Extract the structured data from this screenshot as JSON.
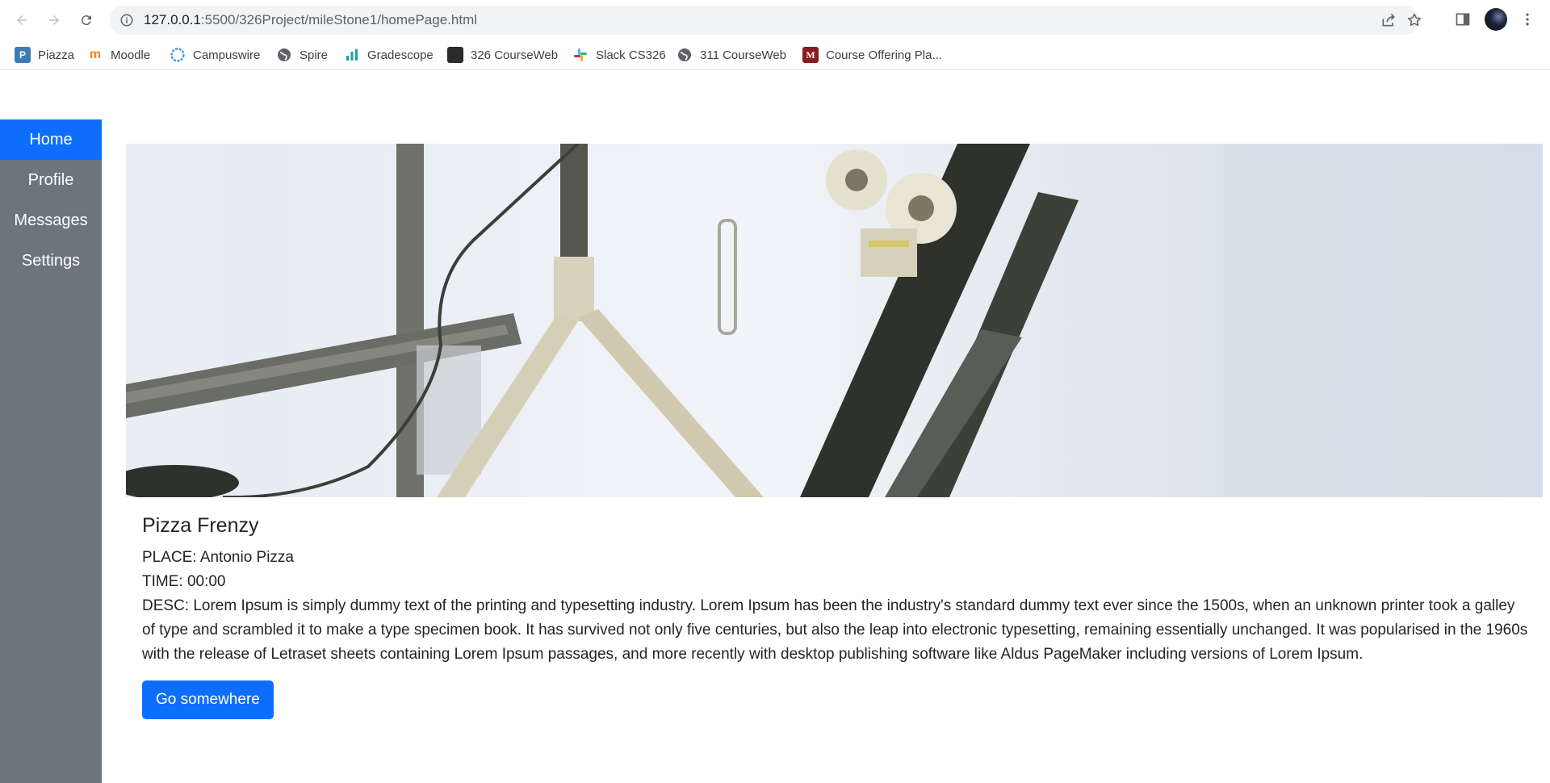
{
  "browser": {
    "url_host": "127.0.0.1",
    "url_path": ":5500/326Project/mileStone1/homePage.html",
    "bookmarks": [
      {
        "label": "Piazza",
        "icon": "piazza-icon",
        "color": "#3e7ab8"
      },
      {
        "label": "Moodle",
        "icon": "moodle-icon",
        "color": "#f98012"
      },
      {
        "label": "Campuswire",
        "icon": "campuswire-icon",
        "color": "#2d8cf0"
      },
      {
        "label": "Spire",
        "icon": "globe-icon",
        "color": "#5f6368"
      },
      {
        "label": "Gradescope",
        "icon": "gradescope-icon",
        "color": "#1fa0a8"
      },
      {
        "label": "326 CourseWeb",
        "icon": "courseweb-icon",
        "color": "#2b2b2b"
      },
      {
        "label": "Slack CS326",
        "icon": "slack-icon",
        "color": "#e01e5a"
      },
      {
        "label": "311 CourseWeb",
        "icon": "globe-icon",
        "color": "#5f6368"
      },
      {
        "label": "Course Offering Pla...",
        "icon": "umass-icon",
        "color": "#881c1c"
      }
    ]
  },
  "sidebar": {
    "items": [
      {
        "label": "Home",
        "active": true
      },
      {
        "label": "Profile",
        "active": false
      },
      {
        "label": "Messages",
        "active": false
      },
      {
        "label": "Settings",
        "active": false
      }
    ]
  },
  "card": {
    "title": "Pizza Frenzy",
    "place": "PLACE: Antonio Pizza",
    "time": "TIME: 00:00",
    "desc": "DESC: Lorem Ipsum is simply dummy text of the printing and typesetting industry. Lorem Ipsum has been the industry's standard dummy text ever since the 1500s, when an unknown printer took a galley of type and scrambled it to make a type specimen book. It has survived not only five centuries, but also the leap into electronic typesetting, remaining essentially unchanged. It was popularised in the 1960s with the release of Letraset sheets containing Lorem Ipsum passages, and more recently with desktop publishing software like Aldus PageMaker including versions of Lorem Ipsum.",
    "button_label": "Go somewhere"
  },
  "colors": {
    "primary": "#0d6efd",
    "sidebar_bg": "#6c757d"
  }
}
